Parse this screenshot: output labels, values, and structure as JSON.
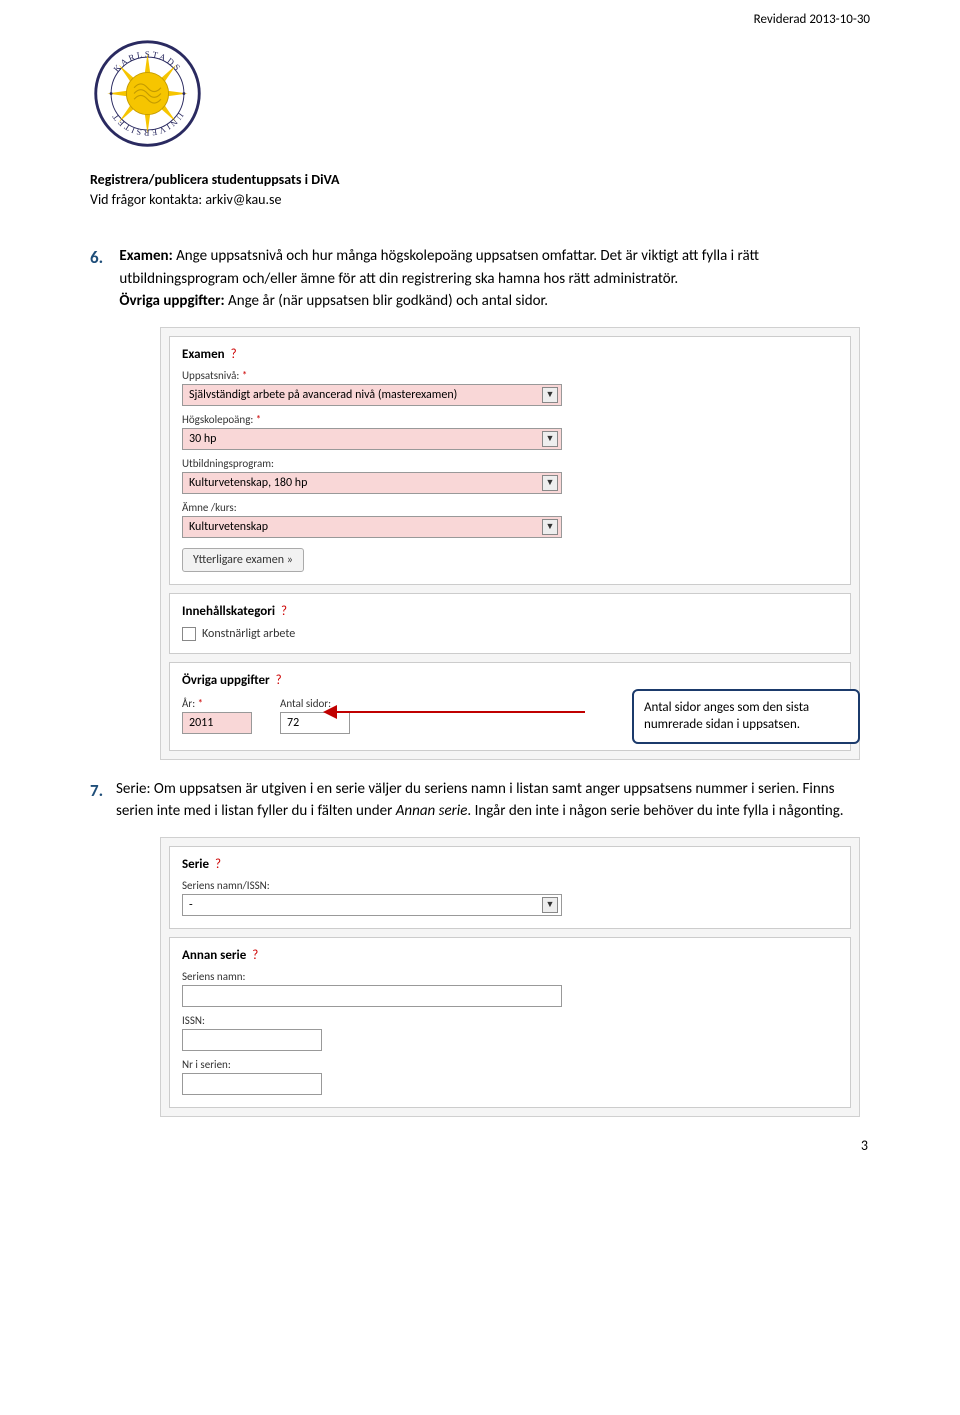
{
  "header": {
    "revised": "Reviderad 2013-10-30"
  },
  "subheader": {
    "line1": "Registrera/publicera studentuppsats i DiVA",
    "line2": "Vid frågor kontakta: arkiv@kau.se"
  },
  "section6": {
    "num": "6.",
    "bold1": "Examen:",
    "text1": " Ange uppsatsnivå och hur många högskolepoäng uppsatsen omfattar. Det är viktigt att fylla i rätt utbildningsprogram och/eller ämne för att din registrering ska hamna hos rätt administratör.",
    "bold2": "Övriga uppgifter:",
    "text2": " Ange år (när uppsatsen blir godkänd) och antal sidor."
  },
  "examen_form": {
    "title": "Examen",
    "label_uppsatsniva": "Uppsatsnivå:",
    "uppsatsniva_value": "Självständigt arbete på avancerad nivå (masterexamen)",
    "label_hogskole": "Högskolepoäng:",
    "hogskole_value": "30 hp",
    "label_utbildning": "Utbildningsprogram:",
    "utbildning_value": "Kulturvetenskap, 180 hp",
    "label_amne": "Ämne /kurs:",
    "amne_value": "Kulturvetenskap",
    "btn_more": "Ytterligare examen »"
  },
  "innehall_form": {
    "title": "Innehållskategori",
    "checkbox_label": "Konstnärligt arbete"
  },
  "ovriga_form": {
    "title": "Övriga uppgifter",
    "label_ar": "År:",
    "ar_value": "2011",
    "label_antal": "Antal sidor:",
    "antal_value": "72"
  },
  "callout": {
    "text": "Antal sidor anges som den sista numrerade sidan i uppsatsen."
  },
  "section7": {
    "num": "7.",
    "bold1": "Serie:",
    "text1": " Om uppsatsen är utgiven i en serie väljer du seriens namn i listan samt anger uppsatsens nummer i serien. Finns serien inte med i listan fyller du i fälten under ",
    "italic1": "Annan serie",
    "text2": ". Ingår den inte i någon serie behöver du inte fylla i någonting."
  },
  "serie_form": {
    "title": "Serie",
    "label_namn": "Seriens namn/ISSN:",
    "namn_value": "-"
  },
  "annan_form": {
    "title": "Annan serie",
    "label_namn": "Seriens namn:",
    "label_issn": "ISSN:",
    "label_nr": "Nr i serien:"
  },
  "question_mark": "?",
  "star": " *",
  "page_num": "3",
  "dropdown_arrow": "▼"
}
